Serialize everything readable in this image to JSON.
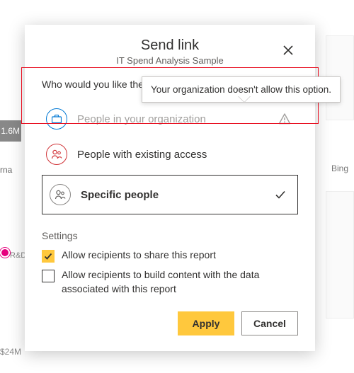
{
  "header": {
    "title": "Send link",
    "subtitle": "IT Spend Analysis Sample"
  },
  "prompt": "Who would you like the link to work for?",
  "tooltip": "Your organization doesn't allow this option.",
  "options": {
    "org": "People in your organization",
    "existing": "People with existing access",
    "specific": "Specific people"
  },
  "settings": {
    "heading": "Settings",
    "allow_share": "Allow recipients to share this report",
    "allow_build": "Allow recipients to build content with the data associated with this report"
  },
  "buttons": {
    "apply": "Apply",
    "cancel": "Cancel"
  },
  "background": {
    "value_1_6m": "1.6M",
    "label_rna": "rna",
    "label_rd": "R&D",
    "value_24m": "$24M",
    "bing": "Bing"
  }
}
